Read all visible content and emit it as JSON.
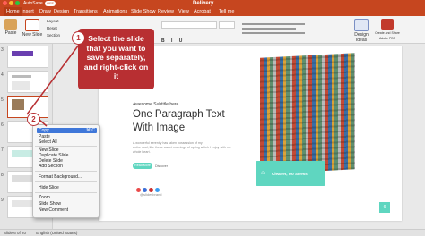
{
  "window": {
    "autosave_label": "AutoSave",
    "autosave_state": "OFF",
    "title": "Delivery"
  },
  "tabs": [
    "Home",
    "Insert",
    "Draw",
    "Design",
    "Transitions",
    "Animations",
    "Slide Show",
    "Review",
    "View",
    "Acrobat",
    "Tell me"
  ],
  "ribbon": {
    "paste_label": "Paste",
    "new_slide_label": "New Slide",
    "layout_label": "Layout",
    "reset_label": "Reset",
    "section_label": "Section",
    "right_buttons": [
      "Design Ideas",
      "Create and Share Adobe PDF"
    ]
  },
  "thumbnails": [
    "3",
    "4",
    "5",
    "6",
    "7",
    "8",
    "9"
  ],
  "slide": {
    "subtitle": "Awesome Subtitle here",
    "title_line1": "One Paragraph Text",
    "title_line2": "With Image",
    "body_line1": "A wonderful serenity has taken possession of my",
    "body_line2": "entire soul, like these sweet mornings of spring which I enjoy with my",
    "body_line3": "whole heart.",
    "button1": "Read More",
    "button2": "Discover",
    "image_caption": "Cleaner, No Stress",
    "social": "@slidesbrand",
    "page_number": "6"
  },
  "callout": {
    "number": "1",
    "text": "Select the slide that you want to save separately, and right-click on it"
  },
  "badge2": "2",
  "context_menu": {
    "items": [
      {
        "label": "Copy",
        "shortcut": "⌘ C",
        "highlighted": true
      },
      {
        "label": "Paste",
        "shortcut": ""
      },
      {
        "label": "Select All",
        "shortcut": ""
      },
      {
        "label": "New Slide",
        "shortcut": ""
      },
      {
        "label": "Duplicate Slide",
        "shortcut": ""
      },
      {
        "label": "Delete Slide",
        "shortcut": ""
      },
      {
        "label": "Add Section",
        "shortcut": ""
      },
      {
        "label": "Format Background...",
        "shortcut": ""
      },
      {
        "label": "Hide Slide",
        "shortcut": ""
      },
      {
        "label": "Zoom...",
        "shortcut": ""
      },
      {
        "label": "Slide Show",
        "shortcut": ""
      },
      {
        "label": "New Comment",
        "shortcut": ""
      }
    ]
  },
  "status": {
    "slide_info": "Slide 6 of 20",
    "language": "English (United States)"
  },
  "colors": {
    "accent": "#c6461f",
    "callout": "#b82f32",
    "teal": "#5fd6c0"
  }
}
